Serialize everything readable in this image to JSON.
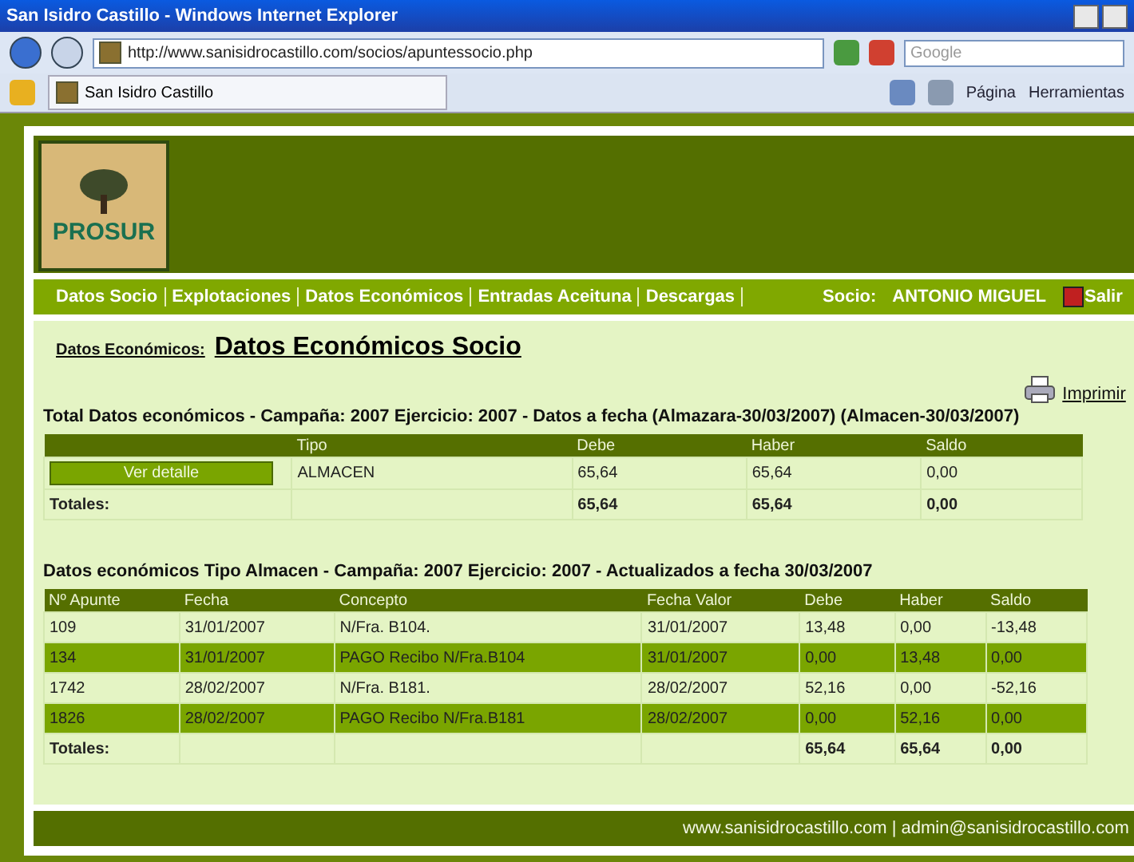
{
  "window": {
    "title": "San Isidro Castillo - Windows Internet Explorer"
  },
  "browser": {
    "address": "http://www.sanisidrocastillo.com/socios/apuntessocio.php",
    "search_placeholder": "Google",
    "tab": "San Isidro Castillo",
    "tools": [
      "Página",
      "Herramientas"
    ]
  },
  "header": {
    "logo": "PROSUR"
  },
  "nav": {
    "items": [
      "Datos Socio",
      "Explotaciones",
      "Datos Económicos",
      "Entradas Aceituna",
      "Descargas"
    ],
    "socio_label": "Socio:",
    "socio_name": "ANTONIO MIGUEL",
    "logout": "Salir"
  },
  "page": {
    "breadcrumb": "Datos Económicos:",
    "title": "Datos Económicos Socio",
    "print": "Imprimir"
  },
  "summary": {
    "title": "Total Datos económicos - Campaña: 2007 Ejercicio: 2007 - Datos a fecha (Almazara-30/03/2007) (Almacen-30/03/2007)",
    "columns": {
      "tipo": "Tipo",
      "debe": "Debe",
      "haber": "Haber",
      "saldo": "Saldo"
    },
    "rows": [
      {
        "button": "Ver detalle",
        "tipo": "ALMACEN",
        "debe": "65,64",
        "haber": "65,64",
        "saldo": "0,00"
      }
    ],
    "totals": {
      "label": "Totales:",
      "debe": "65,64",
      "haber": "65,64",
      "saldo": "0,00"
    }
  },
  "detail": {
    "title": "Datos económicos Tipo Almacen - Campaña: 2007 Ejercicio: 2007 - Actualizados a fecha 30/03/2007",
    "columns": [
      "Nº Apunte",
      "Fecha",
      "Concepto",
      "Fecha Valor",
      "Debe",
      "Haber",
      "Saldo"
    ],
    "rows": [
      {
        "cells": [
          "109",
          "31/01/2007",
          "N/Fra. B104.",
          "31/01/2007",
          "13,48",
          "0,00",
          "-13,48"
        ]
      },
      {
        "cells": [
          "134",
          "31/01/2007",
          "PAGO Recibo N/Fra.B104",
          "31/01/2007",
          "0,00",
          "13,48",
          "0,00"
        ]
      },
      {
        "cells": [
          "1742",
          "28/02/2007",
          "N/Fra. B181.",
          "28/02/2007",
          "52,16",
          "0,00",
          "-52,16"
        ]
      },
      {
        "cells": [
          "1826",
          "28/02/2007",
          "PAGO Recibo N/Fra.B181",
          "28/02/2007",
          "0,00",
          "52,16",
          "0,00"
        ]
      }
    ],
    "totals": {
      "label": "Totales:",
      "debe": "65,64",
      "haber": "65,64",
      "saldo": "0,00"
    }
  },
  "footer": {
    "text": "www.sanisidrocastillo.com | admin@sanisidrocastillo.com"
  }
}
